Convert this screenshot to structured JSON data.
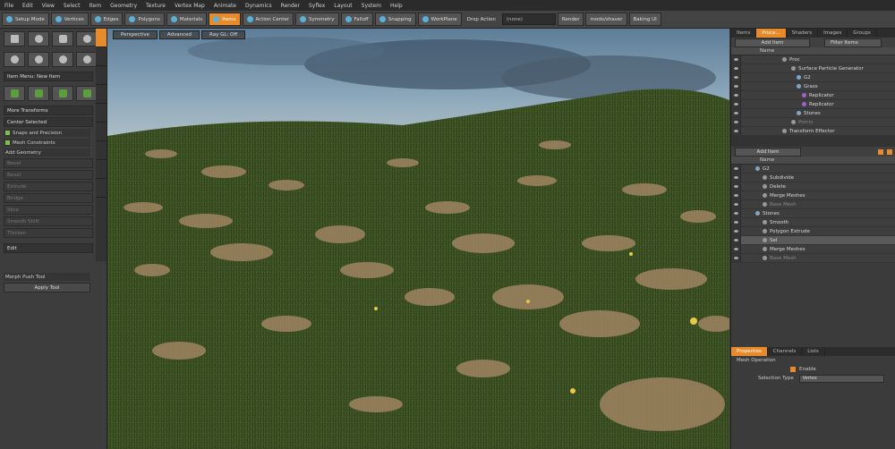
{
  "menubar": [
    "File",
    "Edit",
    "View",
    "Select",
    "Item",
    "Geometry",
    "Texture",
    "Vertex Map",
    "Animate",
    "Dynamics",
    "Render",
    "Syflex",
    "Layout",
    "System",
    "Help"
  ],
  "toolbar": {
    "buttons": [
      {
        "label": "Setup Mode",
        "active": false
      },
      {
        "label": "Vertices",
        "active": false
      },
      {
        "label": "Edges",
        "active": false
      },
      {
        "label": "Polygons",
        "active": false
      },
      {
        "label": "Materials",
        "active": false
      },
      {
        "label": "Items",
        "active": true
      },
      {
        "label": "Action Center",
        "active": false
      },
      {
        "label": "Symmetry",
        "active": false
      },
      {
        "label": "Falloff",
        "active": false
      },
      {
        "label": "Snapping",
        "active": false
      },
      {
        "label": "WorkPlane",
        "active": false
      }
    ],
    "drop_action_label": "Drop Action",
    "drop_action_value": "(none)",
    "render_label": "Render",
    "modo_label": "modo/shaver",
    "baking_label": "Baking UI"
  },
  "left_panel": {
    "item_menu": "Item Menu: New Item",
    "more_transforms": "More Transforms",
    "center_selected": "Center Selected",
    "snaps": "Snaps and Precision",
    "mesh_constraints": "Mesh Constraints",
    "add_geometry": "Add Geometry",
    "geometry_items": [
      "Bevel",
      "Bevel",
      "Extrude",
      "Bridge",
      "Slice",
      "Smooth Shift",
      "Thicken"
    ],
    "edit": "Edit",
    "morph_push": "Morph Push Tool",
    "apply_tool": "Apply Tool"
  },
  "viewport": {
    "tabs": [
      "Perspective",
      "Advanced",
      "Ray GL: Off"
    ]
  },
  "right_panel": {
    "top_tabs": [
      "Items",
      "Proce...",
      "Shaders",
      "Images",
      "Groups"
    ],
    "add_item": "Add Item",
    "filter_items": "Filter Items",
    "name_header": "Name",
    "tree_top": [
      {
        "label": "Proc",
        "dot": "g",
        "dim": false
      },
      {
        "label": "Surface Particle Generator",
        "dot": "g",
        "dim": false
      },
      {
        "label": "G2",
        "dot": "b",
        "dim": false
      },
      {
        "label": "Grass",
        "dot": "b",
        "dim": false
      },
      {
        "label": "Replicator",
        "dot": "p",
        "dim": false
      },
      {
        "label": "Replicator",
        "dot": "p",
        "dim": false
      },
      {
        "label": "Stones",
        "dot": "b",
        "dim": false
      },
      {
        "label": "Points",
        "dot": "g",
        "dim": true
      },
      {
        "label": "Transform Effector",
        "dot": "g",
        "dim": false
      }
    ],
    "add_item2": "Add Item",
    "tree_bottom": [
      {
        "label": "G2",
        "dot": "b",
        "dim": false,
        "sel": false
      },
      {
        "label": "Subdivide",
        "dot": "g",
        "dim": false,
        "sel": false
      },
      {
        "label": "Delete",
        "dot": "g",
        "dim": false,
        "sel": false
      },
      {
        "label": "Merge Meshes",
        "dot": "g",
        "dim": false,
        "sel": false
      },
      {
        "label": "Base Mesh",
        "dot": "g",
        "dim": true,
        "sel": false
      },
      {
        "label": "Stones",
        "dot": "b",
        "dim": false,
        "sel": false
      },
      {
        "label": "Smooth",
        "dot": "g",
        "dim": false,
        "sel": false
      },
      {
        "label": "Polygon Extrude",
        "dot": "g",
        "dim": false,
        "sel": false
      },
      {
        "label": "Sel",
        "dot": "g",
        "dim": false,
        "sel": true
      },
      {
        "label": "Merge Meshes",
        "dot": "g",
        "dim": false,
        "sel": false
      },
      {
        "label": "Base Mesh",
        "dot": "g",
        "dim": true,
        "sel": false
      }
    ],
    "bottom_tabs": [
      "Properties",
      "Channels",
      "Lists"
    ],
    "mesh_operation": "Mesh Operation",
    "enable": "Enable",
    "selection_type_label": "Selection Type",
    "selection_type_value": "Vertex"
  }
}
